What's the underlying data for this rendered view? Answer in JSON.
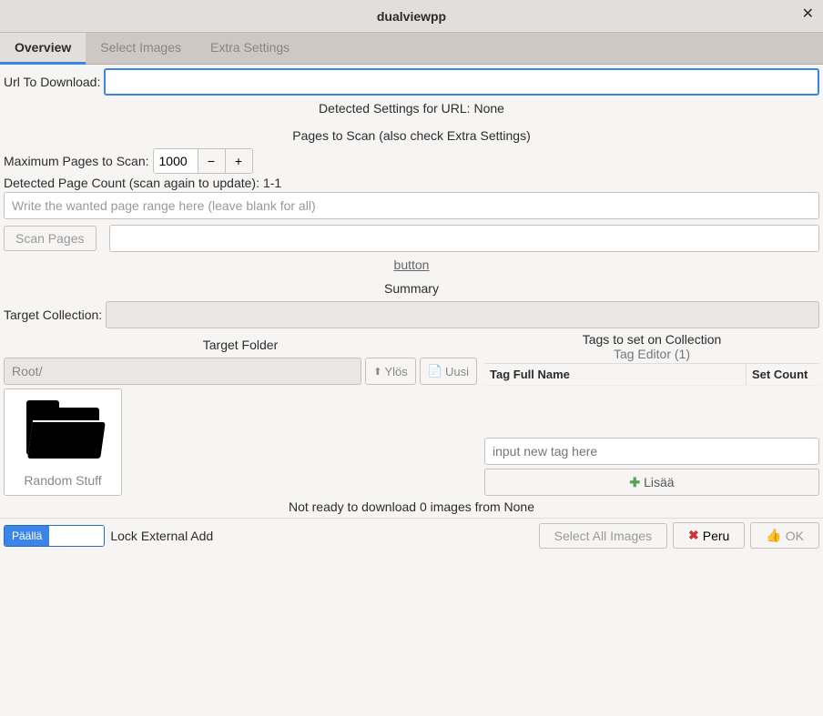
{
  "window": {
    "title": "dualviewpp"
  },
  "tabs": {
    "overview": "Overview",
    "select": "Select Images",
    "extra": "Extra Settings"
  },
  "url": {
    "label": "Url To Download:",
    "value": ""
  },
  "detected_settings": "Detected Settings for URL: None",
  "pages_heading": "Pages to Scan (also check Extra Settings)",
  "max_pages": {
    "label": "Maximum Pages to Scan:",
    "value": "1000"
  },
  "detected_count": {
    "label": "Detected Page Count (scan again to update):",
    "value": "1-1"
  },
  "page_range_placeholder": "Write the wanted page range here (leave blank for all)",
  "scan_button": "Scan Pages",
  "button_link": "button",
  "summary_heading": "Summary",
  "target_collection_label": "Target Collection:",
  "target_folder_heading": "Target Folder",
  "path_value": "Root/",
  "ylos": "Ylös",
  "uusi": "Uusi",
  "folder_item_label": "Random Stuff",
  "tags_heading": "Tags to set on Collection",
  "tag_editor": "Tag Editor (1)",
  "col_name": "Tag Full Name",
  "col_count": "Set Count",
  "new_tag_placeholder": "input new tag here",
  "lisaa": "Lisää",
  "status": "Not ready to download 0 images from None",
  "toggle_on": "Päällä",
  "lock_label": "Lock External Add",
  "select_all": "Select All Images",
  "peru": "Peru",
  "ok": "OK"
}
